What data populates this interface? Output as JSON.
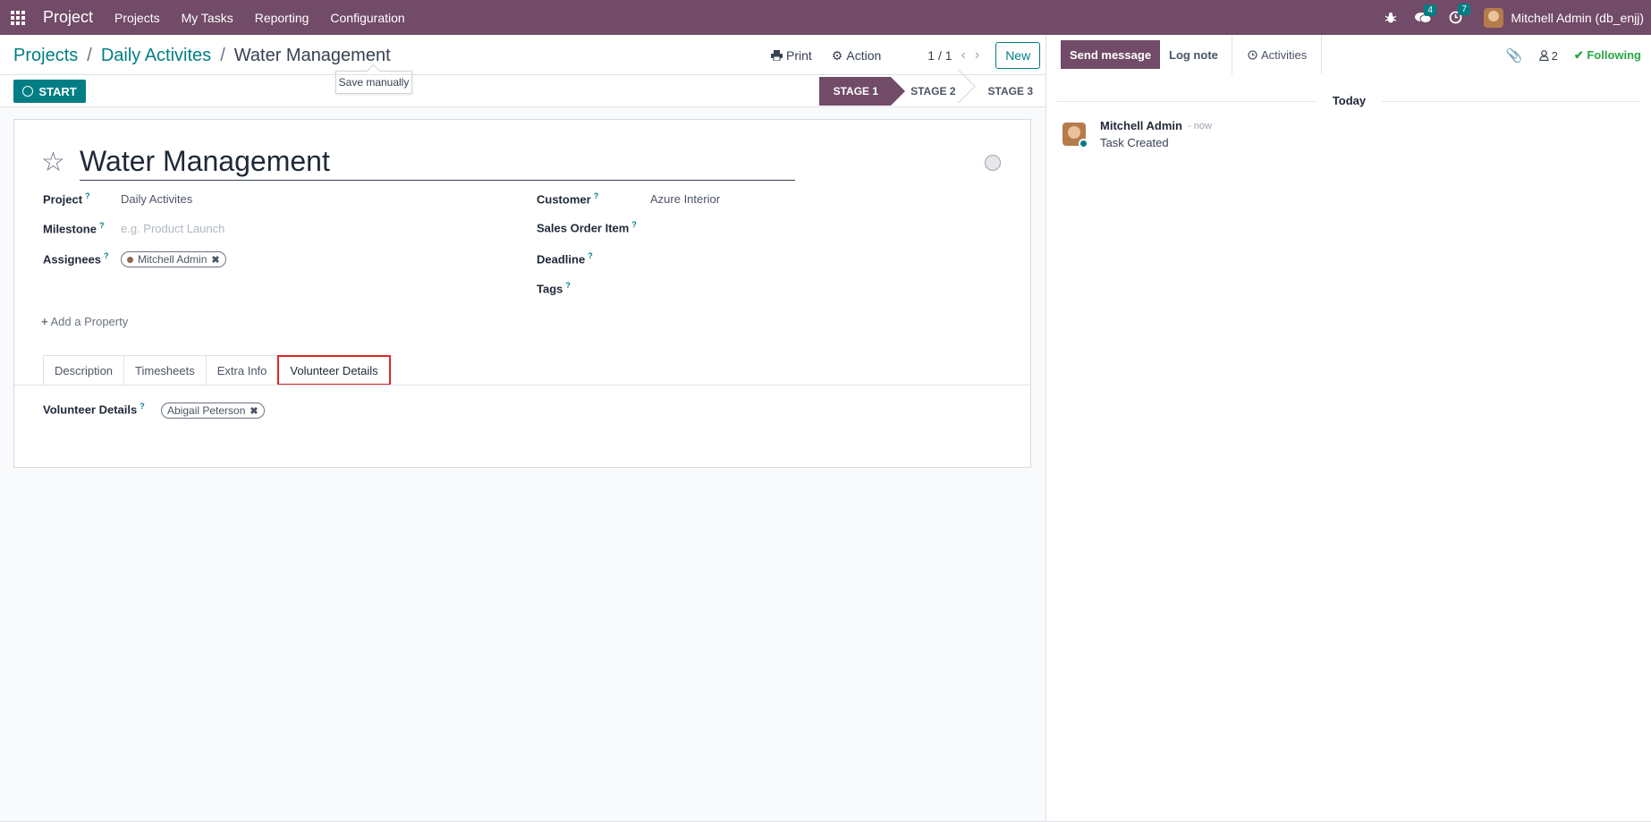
{
  "navbar": {
    "app_name": "Project",
    "menu": [
      "Projects",
      "My Tasks",
      "Reporting",
      "Configuration"
    ],
    "messages_count": "4",
    "activities_count": "7",
    "user": "Mitchell Admin (db_enjj)"
  },
  "breadcrumb": {
    "items": [
      "Projects",
      "Daily Activites"
    ],
    "current": "Water Management"
  },
  "tooltip": "Save manually",
  "actions": {
    "print": "Print",
    "action": "Action",
    "pager": "1 / 1",
    "new": "New"
  },
  "start_button": "START",
  "stages": [
    "STAGE 1",
    "STAGE 2",
    "STAGE 3"
  ],
  "form": {
    "title": "Water Management",
    "fields": {
      "project_label": "Project",
      "project_value": "Daily Activites",
      "milestone_label": "Milestone",
      "milestone_placeholder": "e.g. Product Launch",
      "assignees_label": "Assignees",
      "assignee": "Mitchell Admin",
      "customer_label": "Customer",
      "customer_value": "Azure Interior",
      "sales_order_label": "Sales Order Item",
      "deadline_label": "Deadline",
      "tags_label": "Tags"
    },
    "add_property": "Add a Property",
    "tabs": [
      "Description",
      "Timesheets",
      "Extra Info",
      "Volunteer Details"
    ],
    "volunteer_label": "Volunteer Details",
    "volunteer_value": "Abigail Peterson"
  },
  "chatter": {
    "send_message": "Send message",
    "log_note": "Log note",
    "activities": "Activities",
    "followers_count": "2",
    "following": "Following",
    "date_separator": "Today",
    "message": {
      "author": "Mitchell Admin",
      "time": "- now",
      "body": "Task Created"
    }
  },
  "colors": {
    "brand": "#714b67",
    "accent": "#017e84",
    "following": "#28a745",
    "highlight": "#dc2626"
  }
}
